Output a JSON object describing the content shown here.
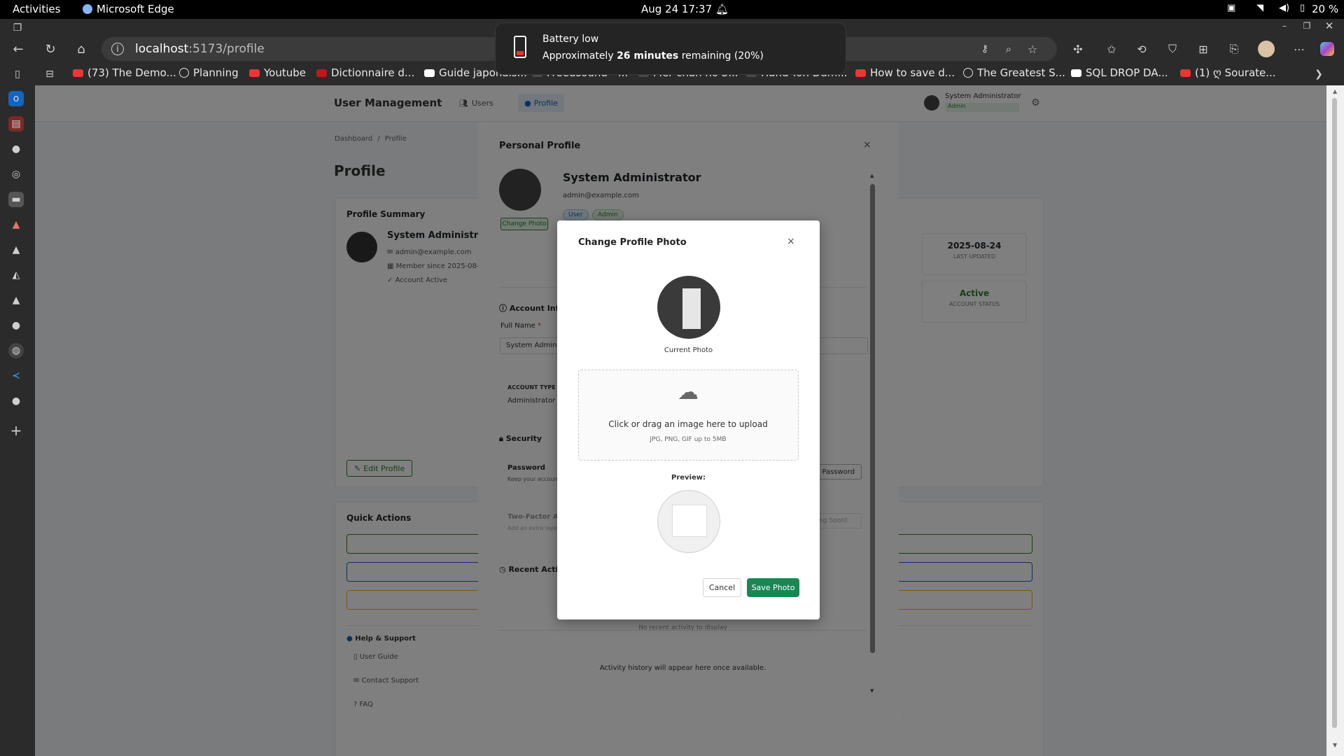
{
  "system_bar": {
    "activities": "Activities",
    "app_name": "Microsoft Edge",
    "datetime": "Aug 24  17:37",
    "battery": "20 %"
  },
  "notification": {
    "title": "Battery low",
    "message_prefix": "Approximately ",
    "message_bold": "26 minutes",
    "message_suffix": " remaining (20%)"
  },
  "browser": {
    "url_host": "localhost",
    "url_path": ":5173/profile",
    "bookmarks": [
      {
        "label": "(73) The Demo...",
        "icon": "youtube-icon"
      },
      {
        "label": "Planning",
        "icon": "globe-icon"
      },
      {
        "label": "Youtube",
        "icon": "youtube-icon"
      },
      {
        "label": "Dictionnaire d...",
        "icon": "dictionary-icon"
      },
      {
        "label": "Guide japonais...",
        "icon": "bookmark-icon"
      },
      {
        "label": "Freedsound - ...",
        "icon": "bookmark-icon"
      },
      {
        "label": "Mer chan ho 3...",
        "icon": "bookmark-icon"
      },
      {
        "label": "Hand-Ton Dum...",
        "icon": "bookmark-icon"
      },
      {
        "label": "How to save d...",
        "icon": "youtube-icon"
      },
      {
        "label": "The Greatest S...",
        "icon": "globe-icon"
      },
      {
        "label": "SQL DROP DA...",
        "icon": "sql-icon"
      },
      {
        "label": "(1) ღ Sourate...",
        "icon": "youtube-icon"
      }
    ]
  },
  "app": {
    "brand": "User Management",
    "nav_users": "Users",
    "nav_profile": "Profile",
    "user_name": "System Administrator",
    "user_role": "Admin",
    "breadcrumb_root": "Dashboard",
    "breadcrumb_sep": "/",
    "breadcrumb_current": "Profile",
    "page_title": "Profile",
    "summary_title": "Profile Summary",
    "summary_name": "System Administrator",
    "summary_email": "admin@example.com",
    "summary_member": "Member since 2025-08-24",
    "summary_status": "Account Active",
    "edit_profile": "Edit Profile",
    "stat_updated_value": "2025-08-24",
    "stat_updated_label": "LAST UPDATED",
    "stat_status_value": "Active",
    "stat_status_label": "ACCOUNT STATUS",
    "quick_actions": "Quick Actions",
    "help_title": "Help & Support",
    "help_guide": "User Guide",
    "help_contact": "Contact Support",
    "help_faq": "FAQ"
  },
  "personal_modal": {
    "title": "Personal Profile",
    "name": "System Administrator",
    "email": "admin@example.com",
    "badge_user": "User",
    "badge_admin": "Admin",
    "change_photo": "Change Photo",
    "account_info": "Account Information",
    "full_name_label": "Full Name",
    "full_name_value": "System Administrator",
    "account_type_label": "ACCOUNT TYPE",
    "account_type_value": "Administrator",
    "security": "Security",
    "password_label": "Password",
    "password_desc": "Keep your account secure",
    "change_password": "Change Password",
    "twofa_label": "Two-Factor Authentication",
    "twofa_desc": "Add an extra layer of security",
    "twofa_status": "(Coming Soon)",
    "recent_activity": "Recent Activity",
    "no_activity": "No recent activity to display",
    "activity_note": "Activity history will appear here once available."
  },
  "photo_modal": {
    "title": "Change Profile Photo",
    "current_photo": "Current Photo",
    "upload_text": "Click or drag an image here to upload",
    "upload_hint": "JPG, PNG, GIF up to 5MB",
    "preview_label": "Preview:",
    "cancel": "Cancel",
    "save": "Save Photo"
  }
}
